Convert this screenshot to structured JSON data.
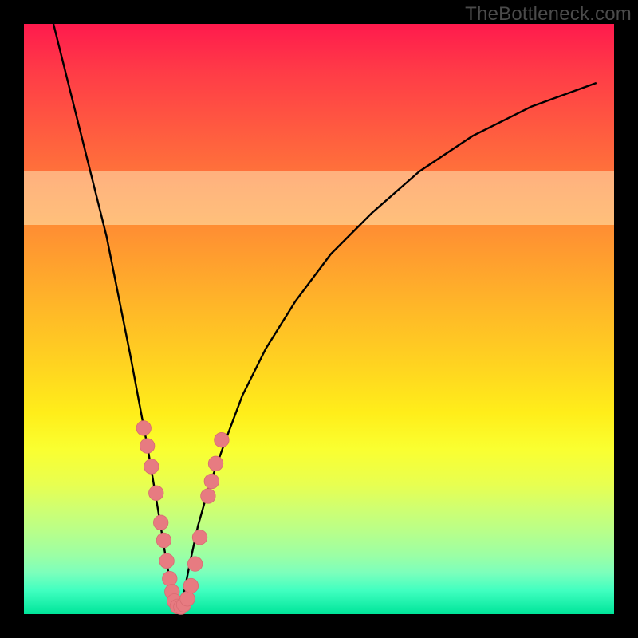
{
  "attribution": "TheBottleneck.com",
  "colors": {
    "curve": "#000000",
    "marker_fill": "#e77b81",
    "marker_stroke": "#d86b72"
  },
  "chart_data": {
    "type": "line",
    "title": "",
    "xlabel": "",
    "ylabel": "",
    "xlim": [
      0,
      100
    ],
    "ylim": [
      0,
      100
    ],
    "note": "Axes are implicit (no numeric tick labels are shown). Values are visual estimates on a 0–100 scale where 0 is left/bottom and 100 is right/top. The two curves descend into a narrow V near x≈25 and re-ascend; pink bead clusters sit on the lower quarter of each curve.",
    "series": [
      {
        "name": "left_curve",
        "x": [
          5,
          8,
          11,
          14,
          16,
          18,
          19.5,
          21,
          22,
          23,
          23.8,
          24.5,
          25,
          25.5,
          26
        ],
        "y": [
          100,
          88,
          76,
          64,
          54,
          44,
          36,
          28,
          22,
          16,
          11,
          7,
          4,
          2,
          0.5
        ]
      },
      {
        "name": "right_curve",
        "x": [
          26.5,
          27.2,
          28.2,
          29.5,
          31.5,
          34,
          37,
          41,
          46,
          52,
          59,
          67,
          76,
          86,
          97
        ],
        "y": [
          1,
          4,
          9,
          15,
          22,
          29,
          37,
          45,
          53,
          61,
          68,
          75,
          81,
          86,
          90
        ]
      }
    ],
    "markers": {
      "name": "pink_beads",
      "points_xy": [
        [
          20.3,
          31.5
        ],
        [
          20.9,
          28.5
        ],
        [
          21.6,
          25.0
        ],
        [
          22.4,
          20.5
        ],
        [
          23.2,
          15.5
        ],
        [
          23.7,
          12.5
        ],
        [
          24.2,
          9.0
        ],
        [
          24.7,
          6.0
        ],
        [
          25.1,
          3.8
        ],
        [
          25.5,
          2.2
        ],
        [
          26.0,
          1.3
        ],
        [
          26.6,
          1.2
        ],
        [
          27.1,
          1.6
        ],
        [
          27.7,
          2.6
        ],
        [
          28.3,
          4.8
        ],
        [
          29.0,
          8.5
        ],
        [
          29.8,
          13.0
        ],
        [
          31.2,
          20.0
        ],
        [
          31.8,
          22.5
        ],
        [
          32.5,
          25.5
        ],
        [
          33.5,
          29.5
        ]
      ],
      "radius_pct": 1.25
    },
    "yellow_band_y_range": [
      66,
      75
    ]
  }
}
